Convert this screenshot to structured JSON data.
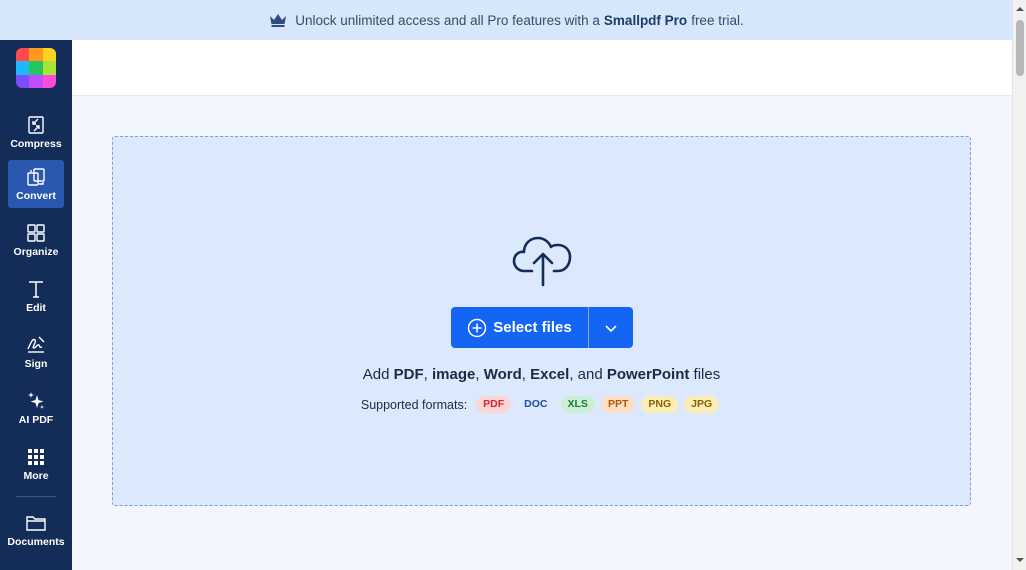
{
  "banner": {
    "prefix": "Unlock unlimited access and all Pro features with a",
    "brand": "Smallpdf Pro",
    "suffix": "free trial.",
    "icon": "crown-icon"
  },
  "sidebar": {
    "logo_colors": [
      "#ff4b4b",
      "#ff9a1f",
      "#ffd21f",
      "#1fb7ff",
      "#22c55e",
      "#a3e635",
      "#7c4dff",
      "#c34bff",
      "#ff4bd8"
    ],
    "items": [
      {
        "label": "Compress",
        "icon": "compress-icon"
      },
      {
        "label": "Convert",
        "icon": "convert-icon",
        "active": true
      },
      {
        "label": "Organize",
        "icon": "organize-icon"
      },
      {
        "label": "Edit",
        "icon": "edit-text-icon"
      },
      {
        "label": "Sign",
        "icon": "signature-icon"
      },
      {
        "label": "AI PDF",
        "icon": "sparkles-icon"
      },
      {
        "label": "More",
        "icon": "grid-icon"
      }
    ],
    "documents": {
      "label": "Documents",
      "icon": "folder-icon"
    }
  },
  "upload": {
    "icon": "cloud-upload-icon",
    "button_label": "Select files",
    "add_prefix": "Add",
    "types": [
      "PDF",
      "image",
      "Word",
      "Excel",
      "PowerPoint"
    ],
    "add_suffix": "files",
    "formats_label": "Supported formats:",
    "formats": [
      {
        "name": "PDF",
        "bg": "#fcd5d6",
        "fg": "#d02530"
      },
      {
        "name": "DOC",
        "bg": "#dce8fc",
        "fg": "#1c4fa1"
      },
      {
        "name": "XLS",
        "bg": "#cdeed6",
        "fg": "#1c7a3b"
      },
      {
        "name": "PPT",
        "bg": "#fde0c4",
        "fg": "#b35509"
      },
      {
        "name": "PNG",
        "bg": "#fbedb6",
        "fg": "#8a6106"
      },
      {
        "name": "JPG",
        "bg": "#fbedb6",
        "fg": "#8a6106"
      }
    ]
  },
  "colors": {
    "sidebar_bg": "#142c58",
    "active_bg": "#2a57b0",
    "primary": "#1565f5",
    "banner_bg": "#d6e6fb",
    "dropzone_bg": "#dce8fc"
  }
}
